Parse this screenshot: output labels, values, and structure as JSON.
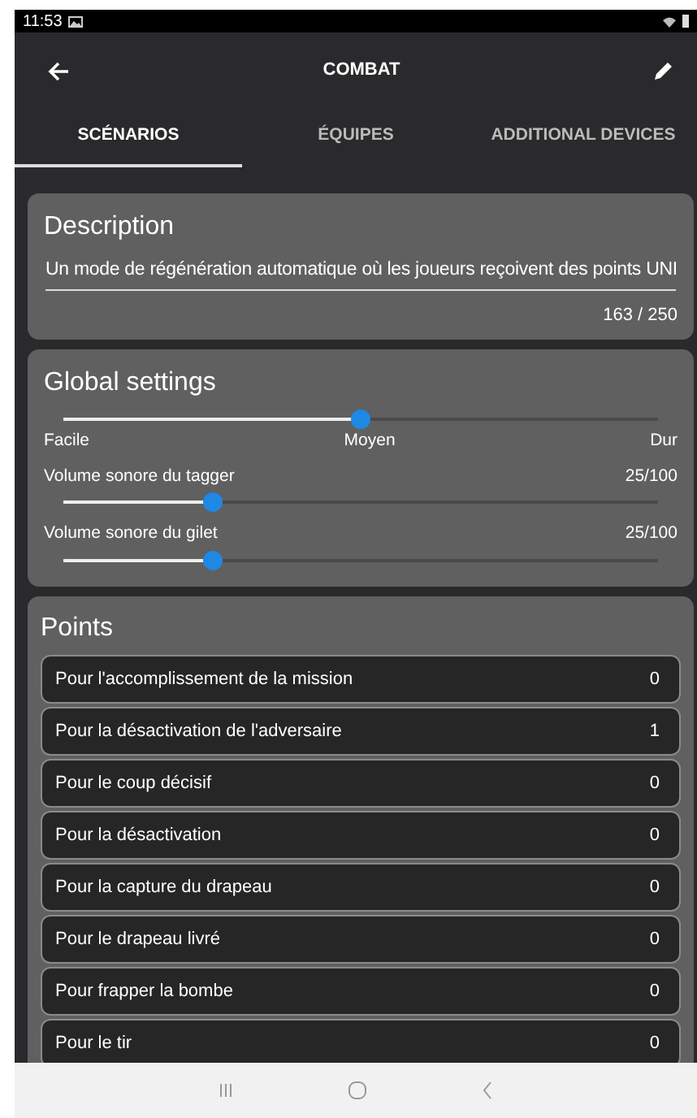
{
  "status_bar": {
    "time": "11:53"
  },
  "app_bar": {
    "title": "COMBAT"
  },
  "tabs": [
    {
      "label": "SCÉNARIOS",
      "selected": true
    },
    {
      "label": "ÉQUIPES",
      "selected": false
    },
    {
      "label": "ADDITIONAL DEVICES",
      "selected": false
    }
  ],
  "description": {
    "title": "Description",
    "value": "Un mode de régénération automatique où les joueurs reçoivent des points UNI",
    "counter": "163 / 250"
  },
  "global_settings": {
    "title": "Global settings",
    "difficulty": {
      "level": 0.5,
      "labels": [
        "Facile",
        "Moyen",
        "Dur"
      ]
    },
    "volumes": [
      {
        "label": "Volume sonore du tagger",
        "reading": "25/100",
        "level": 0.25
      },
      {
        "label": "Volume sonore du gilet",
        "reading": "25/100",
        "level": 0.25
      }
    ]
  },
  "points": {
    "title": "Points",
    "rows": [
      {
        "label": "Pour l'accomplissement de la mission",
        "value": "0"
      },
      {
        "label": "Pour la désactivation de l'adversaire",
        "value": "1"
      },
      {
        "label": "Pour le coup décisif",
        "value": "0"
      },
      {
        "label": "Pour la désactivation",
        "value": "0"
      },
      {
        "label": "Pour la capture du drapeau",
        "value": "0"
      },
      {
        "label": "Pour le drapeau livré",
        "value": "0"
      },
      {
        "label": "Pour frapper la bombe",
        "value": "0"
      },
      {
        "label": "Pour le tir",
        "value": "0"
      }
    ]
  }
}
